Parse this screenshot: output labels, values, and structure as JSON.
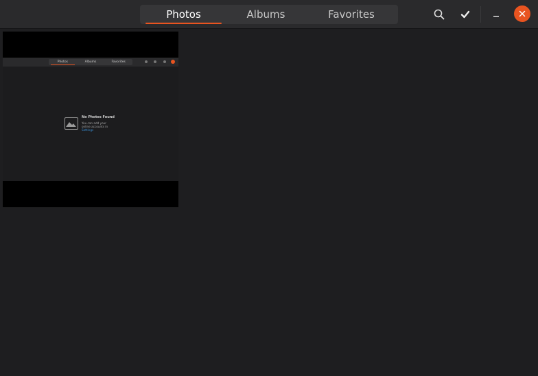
{
  "tabs": [
    {
      "label": "Photos",
      "active": true
    },
    {
      "label": "Albums",
      "active": false
    },
    {
      "label": "Favorites",
      "active": false
    }
  ],
  "icons": {
    "search": "search-icon",
    "select": "check-icon",
    "minimize": "minimize-icon",
    "close": "close-icon"
  },
  "colors": {
    "accent": "#e95420",
    "background": "#1e1e20",
    "headerbar": "#2a2a2c"
  },
  "thumbnail": {
    "tabs": [
      "Photos",
      "Albums",
      "Favorites"
    ],
    "empty_title": "No Photos Found",
    "empty_line1": "You can add your",
    "empty_line2": "online accounts in",
    "empty_link": "Settings"
  }
}
